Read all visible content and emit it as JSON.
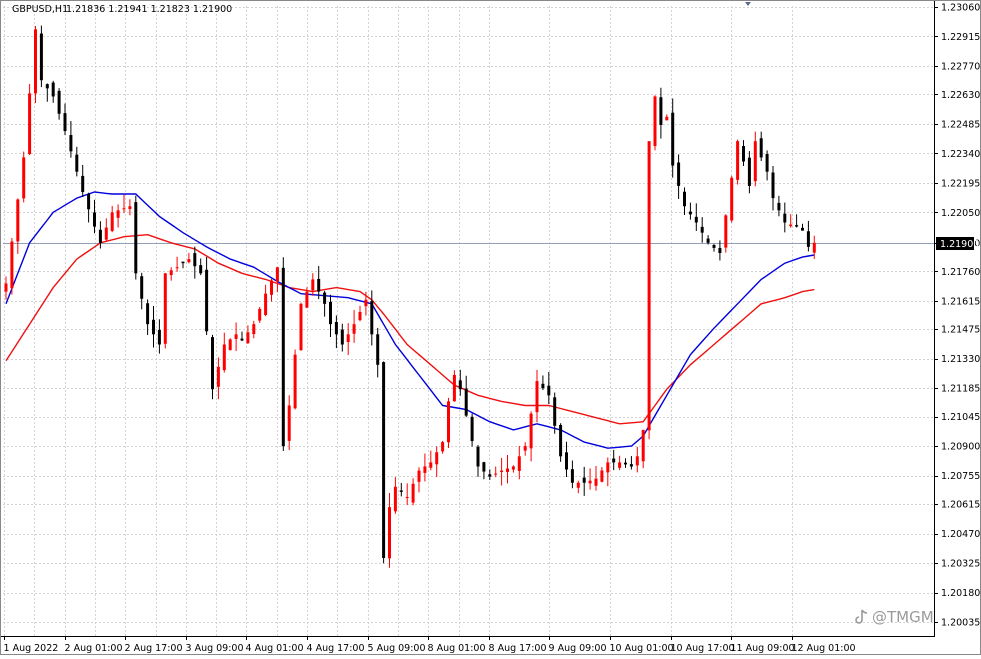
{
  "header": {
    "symbol": "GBPUSD,H1",
    "ohlc": "1.21836 1.21941 1.21823 1.21900"
  },
  "watermark": {
    "text": "@TMGM",
    "icon": "tiktok-note-icon"
  },
  "colors": {
    "background": "#ffffff",
    "grid": "#d3d3d3",
    "bull": "#ff0000",
    "bear": "#000000",
    "ma_fast": "#0000dd",
    "ma_slow": "#ee1111",
    "price_line": "#8fa0b8",
    "price_tag_bg": "#000000",
    "price_tag_text": "#ffffff"
  },
  "chart_data": {
    "type": "candlestick",
    "title": "GBPUSD,H1",
    "x_tick_labels": [
      "1 Aug 2022",
      "2 Aug 01:00",
      "2 Aug 17:00",
      "3 Aug 09:00",
      "4 Aug 01:00",
      "4 Aug 17:00",
      "5 Aug 09:00",
      "8 Aug 01:00",
      "8 Aug 17:00",
      "9 Aug 09:00",
      "10 Aug 01:00",
      "10 Aug 17:00",
      "11 Aug 09:00",
      "12 Aug 01:00"
    ],
    "y_tick_labels": [
      "1.23060",
      "1.22915",
      "1.22770",
      "1.22630",
      "1.22485",
      "1.22340",
      "1.22195",
      "1.22050",
      "1.21900",
      "1.21760",
      "1.21615",
      "1.21475",
      "1.21330",
      "1.21185",
      "1.21045",
      "1.20900",
      "1.20755",
      "1.20615",
      "1.20470",
      "1.20325",
      "1.20180",
      "1.20035"
    ],
    "ylim": [
      1.20035,
      1.2306
    ],
    "current_price": "1.21900",
    "grid": true,
    "series": [
      {
        "name": "",
        "kind": "moving_average_fast",
        "color": "#0000dd"
      },
      {
        "name": "",
        "kind": "moving_average_slow",
        "color": "#ee1111"
      }
    ],
    "price_path": [
      [
        0,
        1.217
      ],
      [
        3,
        1.2232
      ],
      [
        5,
        1.2295
      ],
      [
        6,
        1.227
      ],
      [
        8,
        1.2262
      ],
      [
        10,
        1.2245
      ],
      [
        13,
        1.2215
      ],
      [
        15,
        1.2198
      ],
      [
        16,
        1.219
      ],
      [
        18,
        1.2205
      ],
      [
        21,
        1.2208
      ],
      [
        22,
        1.2175
      ],
      [
        24,
        1.215
      ],
      [
        26,
        1.214
      ],
      [
        27,
        1.2175
      ],
      [
        29,
        1.2178
      ],
      [
        31,
        1.2182
      ],
      [
        33,
        1.2175
      ],
      [
        35,
        1.2118
      ],
      [
        37,
        1.214
      ],
      [
        39,
        1.2145
      ],
      [
        40,
        1.2142
      ],
      [
        42,
        1.215
      ],
      [
        44,
        1.2165
      ],
      [
        46,
        1.2178
      ],
      [
        47,
        1.209
      ],
      [
        48,
        1.211
      ],
      [
        50,
        1.216
      ],
      [
        52,
        1.2172
      ],
      [
        54,
        1.216
      ],
      [
        55,
        1.215
      ],
      [
        57,
        1.214
      ],
      [
        59,
        1.215
      ],
      [
        61,
        1.2162
      ],
      [
        62,
        1.2145
      ],
      [
        63,
        1.213
      ],
      [
        64,
        1.2035
      ],
      [
        65,
        1.206
      ],
      [
        66,
        1.207
      ],
      [
        68,
        1.2065
      ],
      [
        70,
        1.2078
      ],
      [
        72,
        1.2082
      ],
      [
        74,
        1.2092
      ],
      [
        75,
        1.2112
      ],
      [
        76,
        1.2125
      ],
      [
        77,
        1.2118
      ],
      [
        78,
        1.2105
      ],
      [
        80,
        1.208
      ],
      [
        82,
        1.2075
      ],
      [
        84,
        1.2078
      ],
      [
        86,
        1.208
      ],
      [
        88,
        1.209
      ],
      [
        90,
        1.2122
      ],
      [
        92,
        1.2115
      ],
      [
        93,
        1.21
      ],
      [
        94,
        1.2085
      ],
      [
        96,
        1.2072
      ],
      [
        98,
        1.2072
      ],
      [
        100,
        1.2074
      ],
      [
        102,
        1.2082
      ],
      [
        104,
        1.2082
      ],
      [
        106,
        1.208
      ],
      [
        107,
        1.2085
      ],
      [
        108,
        1.2098
      ],
      [
        109,
        1.224
      ],
      [
        110,
        1.2262
      ],
      [
        111,
        1.2248
      ],
      [
        112,
        1.2252
      ],
      [
        113,
        1.2228
      ],
      [
        115,
        1.2208
      ],
      [
        117,
        1.22
      ],
      [
        119,
        1.219
      ],
      [
        121,
        1.2185
      ],
      [
        123,
        1.2222
      ],
      [
        124,
        1.224
      ],
      [
        125,
        1.223
      ],
      [
        126,
        1.2218
      ],
      [
        127,
        1.224
      ],
      [
        128,
        1.2232
      ],
      [
        129,
        1.2225
      ],
      [
        130,
        1.2212
      ],
      [
        132,
        1.22
      ],
      [
        134,
        1.2198
      ],
      [
        135,
        1.2196
      ],
      [
        136,
        1.2188
      ],
      [
        137,
        1.219
      ]
    ],
    "ma_fast_path": [
      [
        0,
        1.216
      ],
      [
        4,
        1.219
      ],
      [
        8,
        1.2205
      ],
      [
        12,
        1.2212
      ],
      [
        15,
        1.2215
      ],
      [
        18,
        1.2214
      ],
      [
        22,
        1.2214
      ],
      [
        26,
        1.2203
      ],
      [
        30,
        1.2195
      ],
      [
        34,
        1.2188
      ],
      [
        38,
        1.2182
      ],
      [
        42,
        1.2178
      ],
      [
        46,
        1.2171
      ],
      [
        50,
        1.2165
      ],
      [
        54,
        1.2164
      ],
      [
        58,
        1.2163
      ],
      [
        62,
        1.216
      ],
      [
        66,
        1.214
      ],
      [
        70,
        1.2125
      ],
      [
        74,
        1.211
      ],
      [
        78,
        1.2108
      ],
      [
        82,
        1.2102
      ],
      [
        86,
        1.2098
      ],
      [
        90,
        1.2101
      ],
      [
        94,
        1.2098
      ],
      [
        98,
        1.2092
      ],
      [
        102,
        1.2089
      ],
      [
        106,
        1.209
      ],
      [
        108,
        1.2095
      ],
      [
        112,
        1.2115
      ],
      [
        116,
        1.2135
      ],
      [
        120,
        1.2148
      ],
      [
        124,
        1.216
      ],
      [
        128,
        1.2172
      ],
      [
        132,
        1.218
      ],
      [
        135,
        1.2183
      ],
      [
        137,
        1.2184
      ]
    ],
    "ma_slow_path": [
      [
        0,
        1.2132
      ],
      [
        4,
        1.215
      ],
      [
        8,
        1.2168
      ],
      [
        12,
        1.2182
      ],
      [
        16,
        1.219
      ],
      [
        20,
        1.2193
      ],
      [
        24,
        1.2194
      ],
      [
        28,
        1.219
      ],
      [
        32,
        1.2187
      ],
      [
        36,
        1.218
      ],
      [
        40,
        1.2175
      ],
      [
        44,
        1.2172
      ],
      [
        48,
        1.2168
      ],
      [
        52,
        1.2166
      ],
      [
        56,
        1.2168
      ],
      [
        60,
        1.2166
      ],
      [
        62,
        1.2162
      ],
      [
        64,
        1.2155
      ],
      [
        68,
        1.214
      ],
      [
        72,
        1.213
      ],
      [
        76,
        1.212
      ],
      [
        80,
        1.2115
      ],
      [
        84,
        1.2112
      ],
      [
        88,
        1.211
      ],
      [
        92,
        1.211
      ],
      [
        96,
        1.2107
      ],
      [
        100,
        1.2104
      ],
      [
        104,
        1.2101
      ],
      [
        108,
        1.2102
      ],
      [
        112,
        1.2118
      ],
      [
        116,
        1.213
      ],
      [
        120,
        1.214
      ],
      [
        124,
        1.215
      ],
      [
        128,
        1.216
      ],
      [
        132,
        1.2163
      ],
      [
        135,
        1.2166
      ],
      [
        137,
        1.2167
      ]
    ]
  }
}
